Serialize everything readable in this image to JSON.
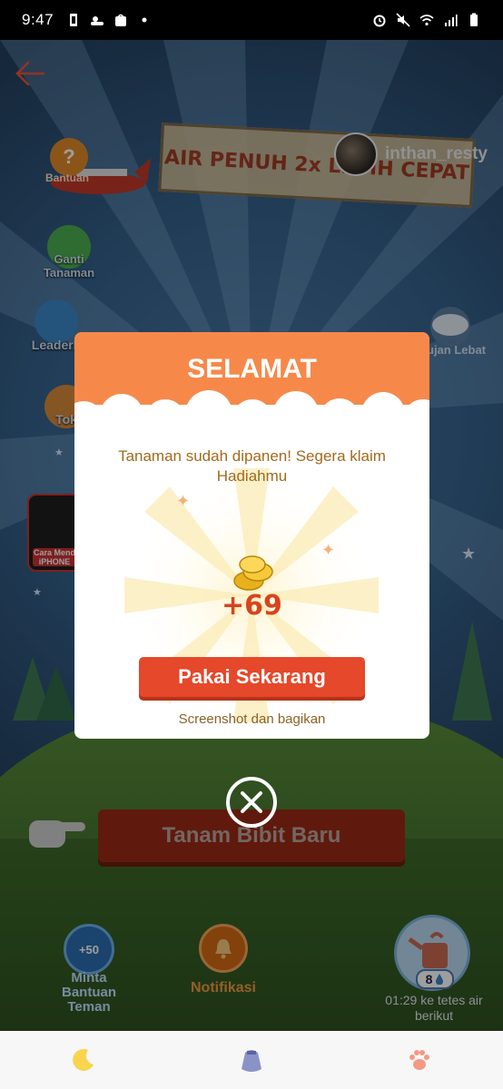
{
  "status_bar": {
    "time": "9:47",
    "icons_left": [
      "battery-saver-icon",
      "weather-icon",
      "shopee-icon",
      "dot-icon"
    ],
    "icons_right": [
      "alarm-icon",
      "mute-icon",
      "wifi-icon",
      "signal-icon",
      "battery-icon"
    ]
  },
  "game": {
    "banner_text": "AIR PENUH 2x LEBIH CEPAT",
    "username": "inthan_resty",
    "side_left": [
      {
        "label": "Bantuan"
      },
      {
        "label": "Ganti Tanaman"
      },
      {
        "label": "Leaderb"
      },
      {
        "label": "Tok"
      },
      {
        "label": "Cara Mend iPHONE"
      }
    ],
    "side_right": {
      "label": "ujan Lebat"
    },
    "plant_button": "Tanam Bibit Baru",
    "bottom_actions": {
      "ask_friends_badge": "+50",
      "ask_friends_label": "Minta Bantuan Teman",
      "notif_label": "Notifikasi",
      "water_count": "8",
      "timer": "01:29 ke tetes air berikut"
    }
  },
  "modal": {
    "title": "SELAMAT",
    "message": "Tanaman sudah dipanen! Segera klaim Hadiahmu",
    "reward_amount": "+69",
    "primary_button": "Pakai Sekarang",
    "share_link": "Screenshot dan bagikan"
  },
  "bottom_nav": [
    "moon-icon",
    "seed-bag-icon",
    "paw-icon"
  ],
  "colors": {
    "modal_header": "#f6894a",
    "primary_button": "#e5482a",
    "reward_text": "#d9421f",
    "message_text": "#a16a1c"
  }
}
